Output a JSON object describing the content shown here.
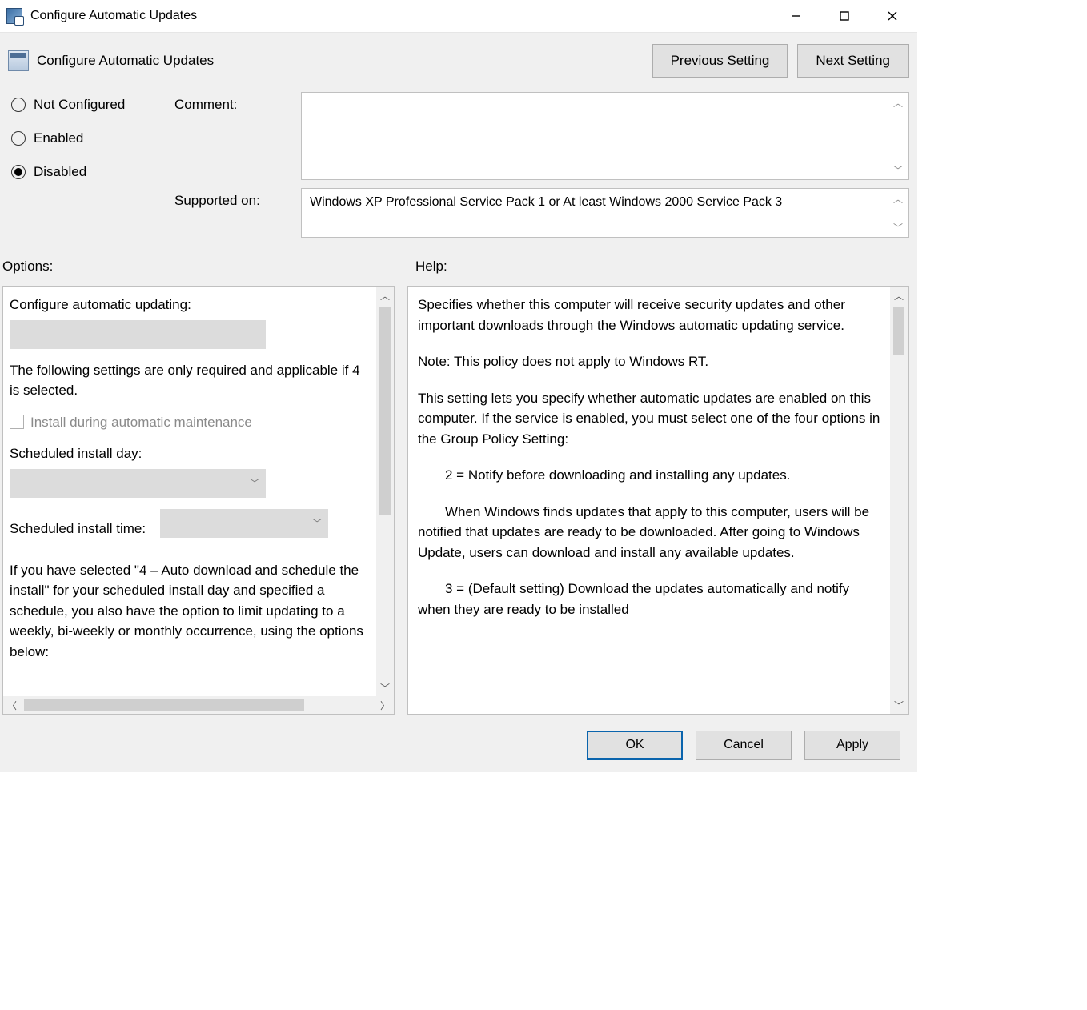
{
  "window": {
    "title": "Configure Automatic Updates"
  },
  "header": {
    "title": "Configure Automatic Updates",
    "prev": "Previous Setting",
    "next": "Next Setting"
  },
  "state": {
    "radios": {
      "not_configured": "Not Configured",
      "enabled": "Enabled",
      "disabled": "Disabled",
      "selected": "disabled"
    },
    "comment_label": "Comment:",
    "comment_value": "",
    "supported_label": "Supported on:",
    "supported_value": "Windows XP Professional Service Pack 1 or At least Windows 2000 Service Pack 3"
  },
  "sections": {
    "options_label": "Options:",
    "help_label": "Help:"
  },
  "options": {
    "configure_label": "Configure automatic updating:",
    "note1": "The following settings are only required and applicable if 4 is selected.",
    "install_maint": "Install during automatic maintenance",
    "sched_day": "Scheduled install day:",
    "sched_time": "Scheduled install time:",
    "note2": "If you have selected \"4 – Auto download and schedule the install\" for your scheduled install day and specified a schedule, you also have the option to limit updating to a weekly, bi-weekly or monthly occurrence, using the options below:"
  },
  "help": {
    "p1": "Specifies whether this computer will receive security updates and other important downloads through the Windows automatic updating service.",
    "p2": "Note: This policy does not apply to Windows RT.",
    "p3": "This setting lets you specify whether automatic updates are enabled on this computer. If the service is enabled, you must select one of the four options in the Group Policy Setting:",
    "p4": "2 = Notify before downloading and installing any updates.",
    "p5": "When Windows finds updates that apply to this computer, users will be notified that updates are ready to be downloaded. After going to Windows Update, users can download and install any available updates.",
    "p6": "3 = (Default setting) Download the updates automatically and notify when they are ready to be installed"
  },
  "footer": {
    "ok": "OK",
    "cancel": "Cancel",
    "apply": "Apply"
  }
}
